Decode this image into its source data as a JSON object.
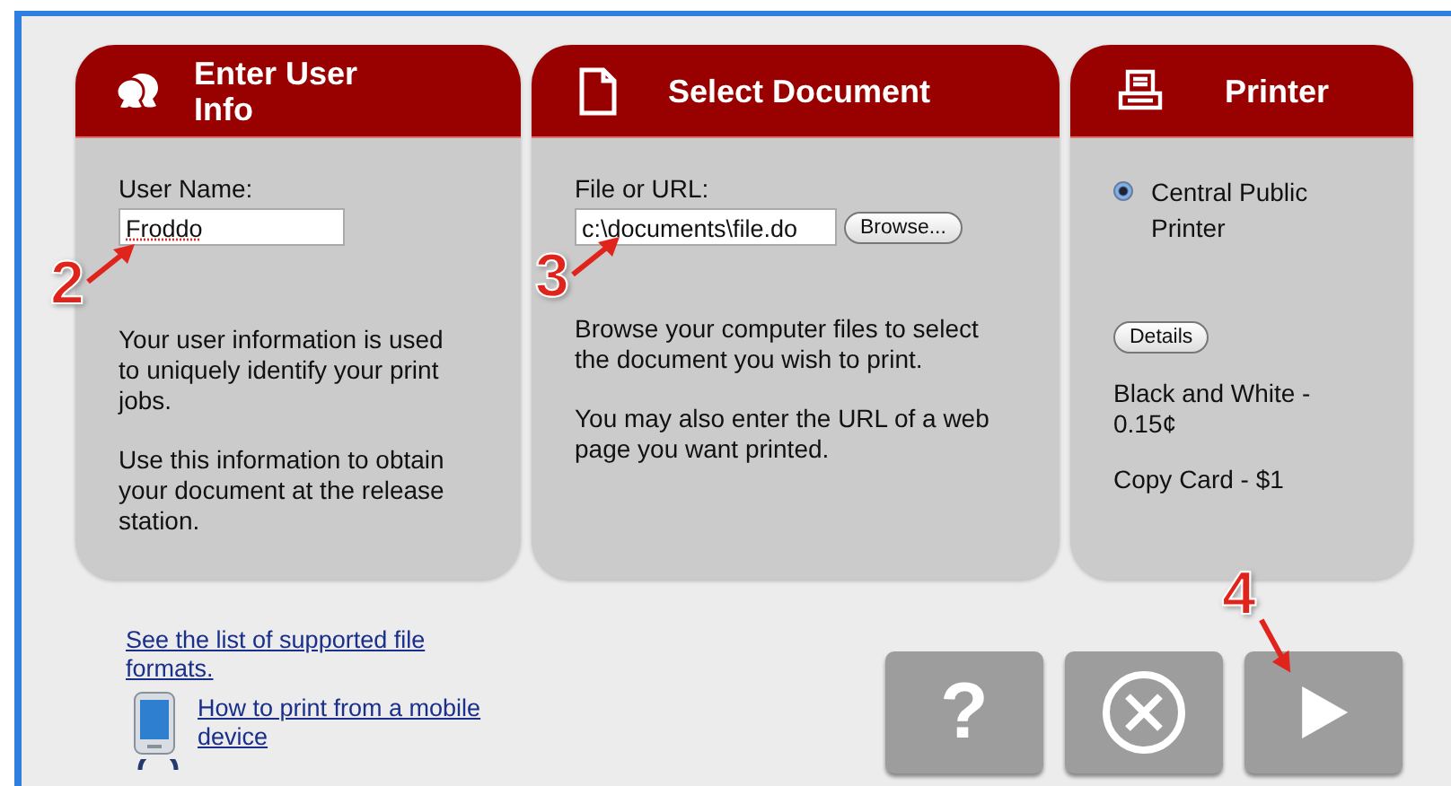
{
  "panels": [
    {
      "kind": "user",
      "title": "Enter User Info",
      "field": {
        "label": "User Name:",
        "value": "Froddo"
      },
      "paragraphs": [
        "Your user information is used to uniquely identify your print jobs.",
        "Use this information to obtain your document at the release station."
      ]
    },
    {
      "kind": "document",
      "title": "Select Document",
      "field": {
        "label": "File or URL:",
        "value": "c:\\documents\\file.do",
        "button": "Browse..."
      },
      "paragraphs": [
        "Browse your computer files to select the document you wish to print.",
        "You may also enter the URL of a web page you want printed."
      ]
    },
    {
      "kind": "printer",
      "title": "Printer",
      "radio": {
        "label": "Central Public Printer",
        "selected": true
      },
      "button": "Details",
      "paragraphs": [
        "Black and White - 0.15¢",
        "Copy Card - $1"
      ]
    }
  ],
  "links": [
    {
      "kind": "plain",
      "text": "See the list of supported file formats."
    },
    {
      "kind": "mobile",
      "text": "How to print from a mobile device"
    }
  ],
  "buttons": [
    {
      "kind": "help",
      "label": "?"
    },
    {
      "kind": "cancel"
    },
    {
      "kind": "next"
    }
  ],
  "annotations": [
    {
      "label": "2"
    },
    {
      "label": "3"
    },
    {
      "label": "4"
    }
  ]
}
